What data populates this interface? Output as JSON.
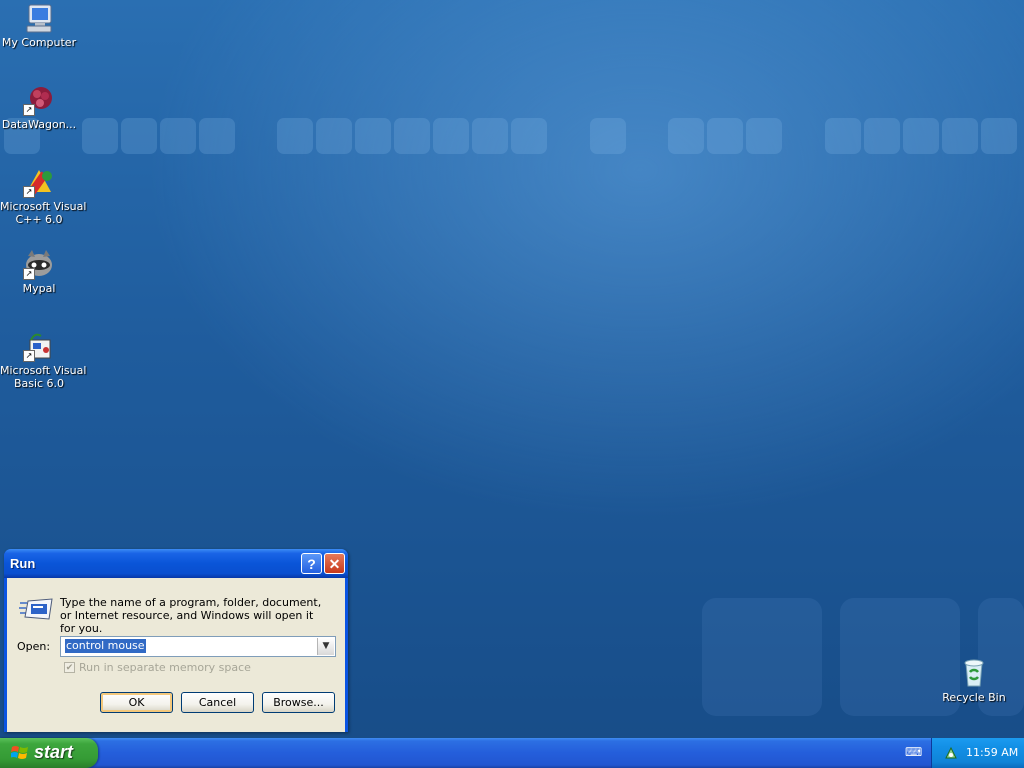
{
  "desktop": {
    "icons": [
      {
        "label": "My Computer",
        "icon": "my-computer-icon"
      },
      {
        "label": "DataWagon...",
        "icon": "datawagon-icon"
      },
      {
        "label": "Microsoft Visual C++ 6.0",
        "line1": "Microsoft Visual",
        "line2": "C++ 6.0",
        "icon": "visual-cpp-icon"
      },
      {
        "label": "Mypal",
        "icon": "mypal-icon"
      },
      {
        "label": "Microsoft Visual Basic 6.0",
        "line1": "Microsoft Visual",
        "line2": "Basic 6.0",
        "icon": "visual-basic-icon"
      },
      {
        "label": "Recycle Bin",
        "icon": "recycle-bin-icon"
      }
    ]
  },
  "run_dialog": {
    "title": "Run",
    "help_glyph": "?",
    "close_glyph": "✕",
    "description": "Type the name of a program, folder, document, or Internet resource, and Windows will open it for you.",
    "open_label": "Open:",
    "open_value": "control mouse",
    "checkbox_label": "Run in separate memory space",
    "checkbox_checked": true,
    "checkbox_enabled": false,
    "ok_label": "OK",
    "cancel_label": "Cancel",
    "browse_label": "Browse..."
  },
  "taskbar": {
    "start_label": "start",
    "clock": "11:59 AM"
  },
  "colors": {
    "titlebar": "#0a54e3",
    "start_button": "#3da63d",
    "taskbar": "#245edb",
    "tray": "#0f84d8",
    "selection": "#316ac5"
  }
}
